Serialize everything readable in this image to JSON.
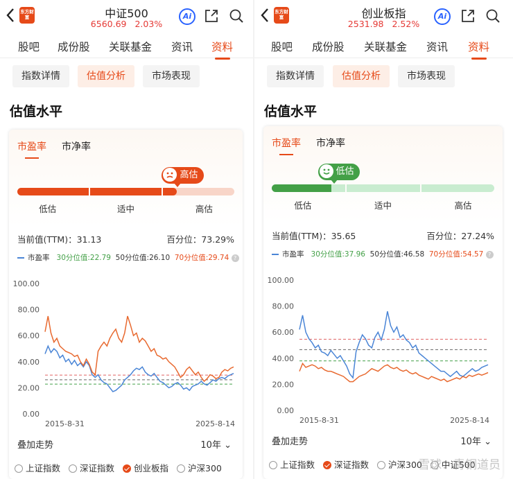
{
  "panels": [
    {
      "id": "left",
      "header": {
        "logo": "东方财富",
        "title": "中证500",
        "price": "6560.69",
        "change": "2.03%",
        "ai": "Ai"
      },
      "tabs": [
        "股吧",
        "成份股",
        "关联基金",
        "资讯",
        "资料"
      ],
      "active_tab": 4,
      "subtabs": [
        "指数详情",
        "估值分析",
        "市场表现"
      ],
      "active_subtab": 1,
      "section_title": "估值水平",
      "valuation_tabs": [
        "市盈率",
        "市净率"
      ],
      "gauge": {
        "marker_label": "高估",
        "level": 0.73,
        "zone": "high",
        "labels": [
          "低估",
          "适中",
          "高估"
        ],
        "color": "#e64a19",
        "track": "#f8d5c8"
      },
      "current_label": "当前值(TTM)：31.13",
      "percentile_label": "百分位：",
      "percentile_value": "73.29%",
      "legend": {
        "series": "市盈率",
        "p30": "30分位值:22.79",
        "p50": "50分位值:26.10",
        "p70": "70分位值:29.74"
      },
      "overlay_label": "叠加走势",
      "period": "10年",
      "checkboxes": [
        {
          "label": "上证指数",
          "checked": false
        },
        {
          "label": "深证指数",
          "checked": false
        },
        {
          "label": "创业板指",
          "checked": true
        },
        {
          "label": "沪深300",
          "checked": false
        }
      ],
      "chart_data": {
        "type": "line",
        "ylim": [
          0,
          100
        ],
        "yticks": [
          "100.00",
          "80.00",
          "60.00",
          "40.00",
          "20.00",
          "0.00"
        ],
        "x_start_label": "2015-8-31",
        "x_end_label": "2025-8-14",
        "series": [
          {
            "name": "市盈率",
            "color": "#4a85d6",
            "values": [
              46,
              52,
              47,
              50,
              48,
              43,
              45,
              40,
              42,
              38,
              41,
              37,
              39,
              36,
              40,
              37,
              30,
              28,
              30,
              26,
              24,
              23,
              20,
              17,
              18,
              20,
              22,
              26,
              28,
              30,
              33,
              35,
              34,
              36,
              32,
              30,
              29,
              31,
              28,
              25,
              24,
              22,
              20,
              21,
              23,
              24,
              22,
              19,
              20,
              18,
              21,
              22,
              23,
              25,
              23,
              22,
              24,
              26,
              25,
              27,
              28,
              27,
              29,
              30,
              31
            ]
          },
          {
            "color": "#e8692f",
            "values": [
              63,
              75,
              62,
              55,
              58,
              52,
              50,
              48,
              47,
              46,
              44,
              45,
              40,
              37,
              42,
              38,
              32,
              30,
              48,
              52,
              55,
              52,
              58,
              62,
              65,
              58,
              55,
              62,
              75,
              68,
              60,
              62,
              55,
              58,
              56,
              52,
              48,
              50,
              45,
              44,
              42,
              43,
              40,
              38,
              36,
              32,
              28,
              30,
              34,
              36,
              33,
              30,
              32,
              28,
              25,
              27,
              30,
              29,
              27,
              28,
              32,
              34,
              33,
              35,
              36
            ]
          }
        ],
        "reference_lines": [
          {
            "label": "70分位值",
            "value": 29.74,
            "color": "#e06060"
          },
          {
            "label": "50分位值",
            "value": 26.1,
            "color": "#666666"
          },
          {
            "label": "30分位值",
            "value": 22.79,
            "color": "#43a047"
          }
        ]
      }
    },
    {
      "id": "right",
      "header": {
        "logo": "东方财富",
        "title": "创业板指",
        "price": "2531.98",
        "change": "2.52%",
        "ai": "Ai"
      },
      "tabs": [
        "股吧",
        "成份股",
        "关联基金",
        "资讯",
        "资料"
      ],
      "active_tab": 4,
      "subtabs": [
        "指数详情",
        "估值分析",
        "市场表现"
      ],
      "active_subtab": 1,
      "section_title": "估值水平",
      "valuation_tabs": [
        "市盈率",
        "市净率"
      ],
      "gauge": {
        "marker_label": "低估",
        "level": 0.27,
        "zone": "low",
        "labels": [
          "低估",
          "适中",
          "高估"
        ],
        "color": "#43a047",
        "track": "#c9ecd0"
      },
      "current_label": "当前值(TTM)：35.65",
      "percentile_label": "百分位：",
      "percentile_value": "27.24%",
      "legend": {
        "series": "市盈率",
        "p30": "30分位值:37.96",
        "p50": "50分位值:46.58",
        "p70": "70分位值:54.57"
      },
      "overlay_label": "叠加走势",
      "period": "10年",
      "checkboxes": [
        {
          "label": "上证指数",
          "checked": false
        },
        {
          "label": "深证指数",
          "checked": true
        },
        {
          "label": "沪深300",
          "checked": false
        },
        {
          "label": "中证500",
          "checked": false
        }
      ],
      "watermark": "雪球：青铜道员",
      "chart_data": {
        "type": "line",
        "ylim": [
          0,
          100
        ],
        "yticks": [
          "100.00",
          "80.00",
          "60.00",
          "40.00",
          "20.00",
          "0.00"
        ],
        "x_start_label": "2015-8-31",
        "x_end_label": "2025-8-14",
        "series": [
          {
            "name": "市盈率",
            "color": "#4a85d6",
            "values": [
              62,
              73,
              60,
              55,
              52,
              48,
              50,
              45,
              44,
              42,
              46,
              43,
              40,
              42,
              38,
              34,
              28,
              25,
              45,
              52,
              58,
              55,
              50,
              48,
              56,
              60,
              54,
              62,
              76,
              65,
              60,
              64,
              56,
              58,
              54,
              52,
              48,
              50,
              44,
              42,
              40,
              38,
              36,
              34,
              32,
              30,
              30,
              28,
              26,
              28,
              30,
              27,
              26,
              28,
              30,
              32,
              30,
              31,
              33,
              34,
              35
            ]
          },
          {
            "color": "#e8692f",
            "values": [
              30,
              36,
              33,
              34,
              35,
              34,
              32,
              33,
              31,
              30,
              30,
              29,
              28,
              27,
              26,
              24,
              22,
              22,
              24,
              26,
              27,
              28,
              30,
              32,
              31,
              30,
              32,
              34,
              35,
              33,
              32,
              33,
              31,
              30,
              31,
              29,
              28,
              29,
              27,
              26,
              25,
              24,
              26,
              25,
              24,
              23,
              24,
              22,
              23,
              24,
              25,
              24,
              26,
              25,
              27,
              26,
              27,
              28,
              27,
              28,
              29
            ]
          }
        ],
        "reference_lines": [
          {
            "label": "70分位值",
            "value": 54.57,
            "color": "#e06060"
          },
          {
            "label": "50分位值",
            "value": 46.58,
            "color": "#666666"
          },
          {
            "label": "30分位值",
            "value": 37.96,
            "color": "#43a047"
          }
        ]
      }
    }
  ]
}
